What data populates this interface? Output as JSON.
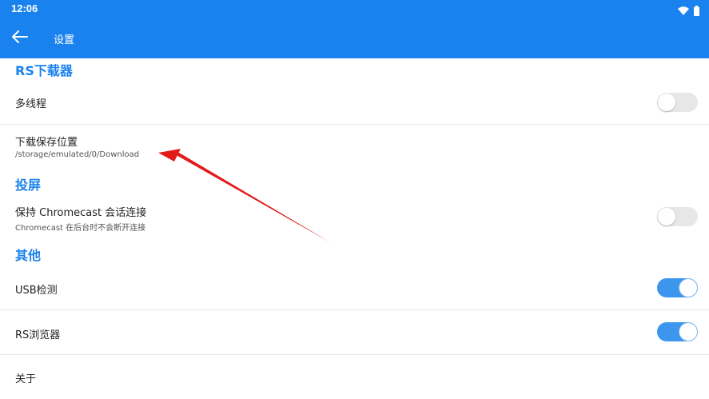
{
  "status_bar": {
    "time": "12:06",
    "icons": [
      "wifi-icon",
      "battery-icon"
    ]
  },
  "app_bar": {
    "title": "设置",
    "back_icon": "arrow-left-icon"
  },
  "sections": {
    "downloader": {
      "header": "RS下载器",
      "multithread": {
        "title": "多线程",
        "enabled": false
      },
      "save_location": {
        "title": "下载保存位置",
        "subtitle": "/storage/emulated/0/Download"
      }
    },
    "cast": {
      "header": "投屏",
      "keep_session": {
        "title": "保持 Chromecast 会话连接",
        "subtitle": "Chromecast 在后台时不会断开连接",
        "enabled": false
      }
    },
    "other": {
      "header": "其他",
      "usb_detect": {
        "title": "USB检测",
        "enabled": true
      },
      "rs_browser": {
        "title": "RS浏览器",
        "enabled": true
      },
      "about": {
        "title": "关于"
      }
    }
  },
  "colors": {
    "accent": "#1a82ee",
    "toggle_on": "#3d96ee",
    "toggle_off": "#e7e7e7",
    "annotation_arrow": "#e21b1b"
  }
}
